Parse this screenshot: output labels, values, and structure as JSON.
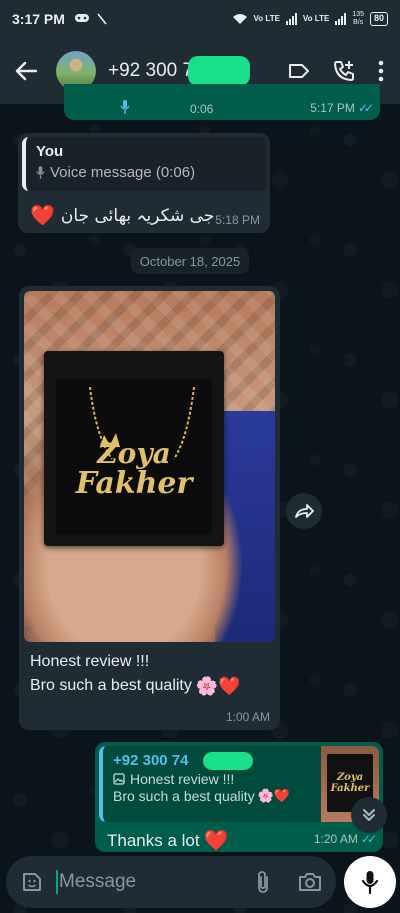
{
  "status_bar": {
    "time": "3:17 PM",
    "net_speed": "135",
    "net_unit": "B/s",
    "lte1": "Vo LTE",
    "lte2": "Vo LTE",
    "battery": "80"
  },
  "header": {
    "contact_name": "+92 300 7",
    "icons": [
      "back-arrow-icon",
      "label-icon",
      "add-call-icon",
      "more-vert-icon"
    ]
  },
  "messages": {
    "prev_out": {
      "duration": "0:06",
      "time": "5:17 PM"
    },
    "reply1": {
      "quote_author": "You",
      "quote_text": "Voice message (0:06)",
      "text": "جی شکریہ بھائی جان",
      "emoji": "❤️",
      "time": "5:18 PM"
    },
    "date_chip": "October 18, 2025",
    "photo_msg": {
      "necklace_line1": "Zoya",
      "necklace_line2": "Fakher",
      "caption_line1": "Honest review !!!",
      "caption_line2": "Bro such a best quality",
      "caption_emojis": "🌸❤️",
      "time": "1:00 AM"
    },
    "reply2": {
      "quote_author": "+92 300 74",
      "quote_line1": "Honest review !!!",
      "quote_line2": "Bro such a best quality",
      "quote_emojis": "🌸❤️",
      "text": "Thanks a lot",
      "emoji": "❤️",
      "time": "1:20 AM"
    }
  },
  "composer": {
    "placeholder": "Message"
  },
  "colors": {
    "bg": "#0b141a",
    "bar": "#1f2c34",
    "incoming": "#1f2c34",
    "outgoing": "#005c4b",
    "read_ticks": "#53bdeb",
    "accent": "#00a884"
  }
}
